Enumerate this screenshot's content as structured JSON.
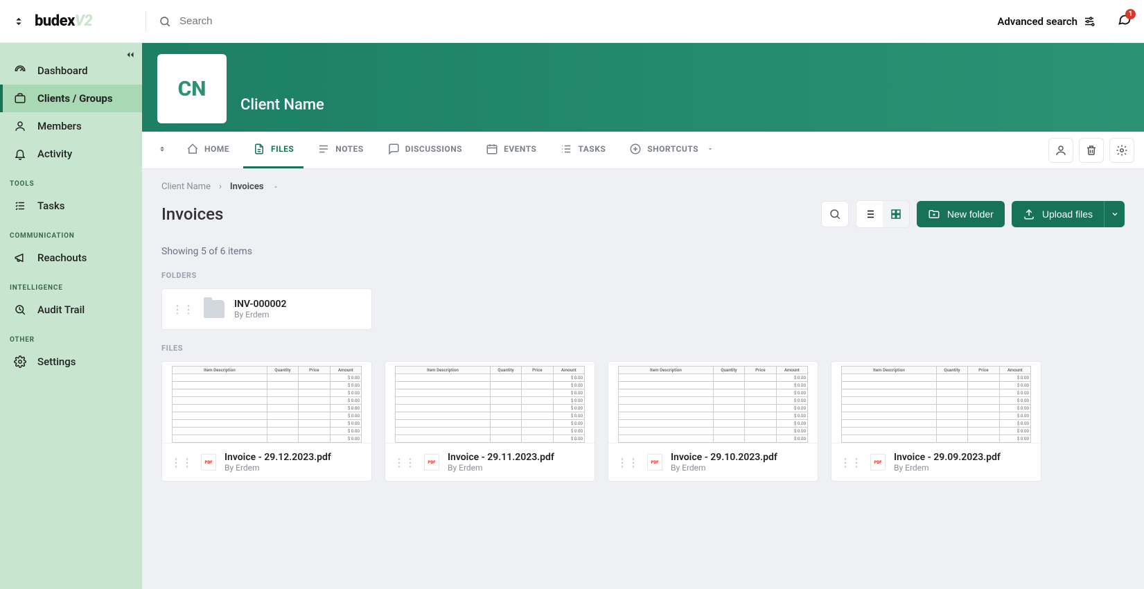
{
  "brand": {
    "name": "budex",
    "suffix": "V2"
  },
  "search": {
    "placeholder": "Search"
  },
  "header": {
    "advanced_search": "Advanced search",
    "notification_count": "1"
  },
  "sidebar": {
    "items": [
      {
        "label": "Dashboard"
      },
      {
        "label": "Clients / Groups"
      },
      {
        "label": "Members"
      },
      {
        "label": "Activity"
      }
    ],
    "tools_label": "TOOLS",
    "tools": [
      {
        "label": "Tasks"
      }
    ],
    "comm_label": "COMMUNICATION",
    "comm": [
      {
        "label": "Reachouts"
      }
    ],
    "intel_label": "INTELLIGENCE",
    "intel": [
      {
        "label": "Audit Trail"
      }
    ],
    "other_label": "OTHER",
    "other": [
      {
        "label": "Settings"
      }
    ]
  },
  "client": {
    "initials": "CN",
    "name": "Client Name"
  },
  "tabs": {
    "home": "HOME",
    "files": "FILES",
    "notes": "NOTES",
    "discussions": "DISCUSSIONS",
    "events": "EVENTS",
    "tasks": "TASKS",
    "shortcuts": "SHORTCUTS"
  },
  "breadcrumb": {
    "root": "Client Name",
    "current": "Invoices"
  },
  "page": {
    "title": "Invoices",
    "summary": "Showing 5 of 6 items"
  },
  "buttons": {
    "new_folder": "New folder",
    "upload_files": "Upload files"
  },
  "sections": {
    "folders": "FOLDERS",
    "files": "FILES"
  },
  "folders": [
    {
      "name": "INV-000002",
      "by": "By Erdem"
    }
  ],
  "preview_headers": [
    "Item Description",
    "Quantity",
    "Price",
    "Amount"
  ],
  "preview_amount": "$ 0.00",
  "files": [
    {
      "name": "Invoice - 29.12.2023.pdf",
      "by": "By Erdem",
      "badge": "PDF"
    },
    {
      "name": "Invoice - 29.11.2023.pdf",
      "by": "By Erdem",
      "badge": "PDF"
    },
    {
      "name": "Invoice - 29.10.2023.pdf",
      "by": "By Erdem",
      "badge": "PDF"
    },
    {
      "name": "Invoice - 29.09.2023.pdf",
      "by": "By Erdem",
      "badge": "PDF"
    }
  ]
}
